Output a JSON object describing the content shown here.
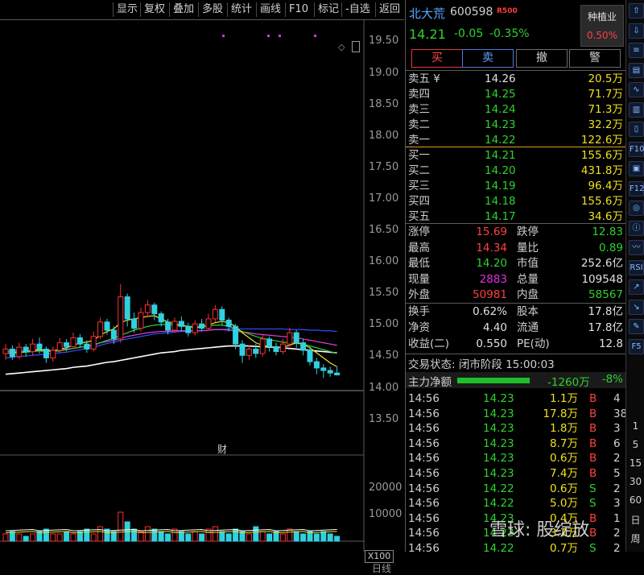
{
  "toolbar": {
    "buttons": [
      "显示",
      "复权",
      "叠加",
      "多股",
      "统计",
      "画线",
      "F10",
      "标记",
      "-自选",
      "返回"
    ]
  },
  "chart": {
    "price_ticks": [
      "19.50",
      "19.00",
      "18.50",
      "18.00",
      "17.50",
      "17.00",
      "16.50",
      "16.00",
      "15.50",
      "15.00",
      "14.50",
      "14.00",
      "13.50"
    ],
    "volume_ticks": [
      "20000",
      "10000"
    ],
    "marker": "财",
    "zoom": "X100",
    "period": "日线",
    "candles": [
      {
        "o": 14.55,
        "c": 14.62,
        "h": 14.7,
        "l": 14.45
      },
      {
        "o": 14.62,
        "c": 14.5,
        "h": 14.68,
        "l": 14.45
      },
      {
        "o": 14.5,
        "c": 14.65,
        "h": 14.72,
        "l": 14.46
      },
      {
        "o": 14.65,
        "c": 14.58,
        "h": 14.7,
        "l": 14.5
      },
      {
        "o": 14.58,
        "c": 14.7,
        "h": 14.78,
        "l": 14.52
      },
      {
        "o": 14.7,
        "c": 14.62,
        "h": 14.8,
        "l": 14.55
      },
      {
        "o": 14.62,
        "c": 14.48,
        "h": 14.66,
        "l": 14.4
      },
      {
        "o": 14.48,
        "c": 14.6,
        "h": 14.66,
        "l": 14.42
      },
      {
        "o": 14.6,
        "c": 14.72,
        "h": 14.8,
        "l": 14.56
      },
      {
        "o": 14.72,
        "c": 14.66,
        "h": 14.78,
        "l": 14.58
      },
      {
        "o": 14.66,
        "c": 14.8,
        "h": 14.88,
        "l": 14.62
      },
      {
        "o": 14.8,
        "c": 14.7,
        "h": 14.86,
        "l": 14.64
      },
      {
        "o": 14.7,
        "c": 14.62,
        "h": 14.76,
        "l": 14.56
      },
      {
        "o": 14.62,
        "c": 14.82,
        "h": 14.9,
        "l": 14.58
      },
      {
        "o": 14.82,
        "c": 15.05,
        "h": 15.12,
        "l": 14.78
      },
      {
        "o": 15.05,
        "c": 14.92,
        "h": 15.1,
        "l": 14.85
      },
      {
        "o": 14.92,
        "c": 14.78,
        "h": 14.98,
        "l": 14.7
      },
      {
        "o": 14.78,
        "c": 15.45,
        "h": 15.65,
        "l": 14.72
      },
      {
        "o": 15.45,
        "c": 15.1,
        "h": 15.5,
        "l": 14.98
      },
      {
        "o": 15.1,
        "c": 14.95,
        "h": 15.2,
        "l": 14.88
      },
      {
        "o": 14.95,
        "c": 15.2,
        "h": 15.28,
        "l": 14.9
      },
      {
        "o": 15.2,
        "c": 15.32,
        "h": 15.4,
        "l": 15.12
      },
      {
        "o": 15.32,
        "c": 15.18,
        "h": 15.36,
        "l": 15.08
      },
      {
        "o": 15.18,
        "c": 15.05,
        "h": 15.22,
        "l": 14.98
      },
      {
        "o": 15.05,
        "c": 14.92,
        "h": 15.1,
        "l": 14.85
      },
      {
        "o": 14.92,
        "c": 15.06,
        "h": 15.12,
        "l": 14.88
      },
      {
        "o": 15.06,
        "c": 14.98,
        "h": 15.14,
        "l": 14.9
      },
      {
        "o": 14.98,
        "c": 14.88,
        "h": 15.04,
        "l": 14.82
      },
      {
        "o": 14.88,
        "c": 15.02,
        "h": 15.08,
        "l": 14.84
      },
      {
        "o": 15.02,
        "c": 14.95,
        "h": 15.1,
        "l": 14.9
      },
      {
        "o": 14.95,
        "c": 15.1,
        "h": 15.18,
        "l": 14.92
      },
      {
        "o": 15.1,
        "c": 15.25,
        "h": 15.32,
        "l": 15.05
      },
      {
        "o": 15.25,
        "c": 15.08,
        "h": 15.3,
        "l": 15.0
      },
      {
        "o": 15.08,
        "c": 14.98,
        "h": 15.12,
        "l": 14.9
      },
      {
        "o": 14.98,
        "c": 14.7,
        "h": 15.02,
        "l": 14.62
      },
      {
        "o": 14.7,
        "c": 14.52,
        "h": 14.76,
        "l": 14.4
      },
      {
        "o": 14.52,
        "c": 14.62,
        "h": 14.68,
        "l": 14.45
      },
      {
        "o": 14.62,
        "c": 14.55,
        "h": 14.7,
        "l": 14.48
      },
      {
        "o": 14.55,
        "c": 14.78,
        "h": 14.86,
        "l": 14.5
      },
      {
        "o": 14.78,
        "c": 14.66,
        "h": 14.82,
        "l": 14.58
      },
      {
        "o": 14.66,
        "c": 14.58,
        "h": 14.72,
        "l": 14.52
      },
      {
        "o": 14.58,
        "c": 14.7,
        "h": 14.78,
        "l": 14.54
      },
      {
        "o": 14.7,
        "c": 14.88,
        "h": 14.96,
        "l": 14.66
      },
      {
        "o": 14.88,
        "c": 14.72,
        "h": 14.92,
        "l": 14.64
      },
      {
        "o": 14.72,
        "c": 14.6,
        "h": 14.78,
        "l": 14.52
      },
      {
        "o": 14.6,
        "c": 14.42,
        "h": 14.66,
        "l": 14.36
      },
      {
        "o": 14.42,
        "c": 14.32,
        "h": 14.48,
        "l": 14.22
      },
      {
        "o": 14.32,
        "c": 14.28,
        "h": 14.38,
        "l": 14.16
      },
      {
        "o": 14.28,
        "c": 14.24,
        "h": 14.34,
        "l": 14.18
      },
      {
        "o": 14.24,
        "c": 14.21,
        "h": 14.34,
        "l": 14.2
      }
    ],
    "ma_lines": [
      {
        "color": "#ffffff",
        "values": [
          14.22,
          14.23,
          14.24,
          14.25,
          14.26,
          14.27,
          14.28,
          14.29,
          14.3,
          14.31,
          14.33,
          14.34,
          14.35,
          14.37,
          14.39,
          14.41,
          14.42,
          14.44,
          14.46,
          14.48,
          14.5,
          14.52,
          14.54,
          14.56,
          14.57,
          14.58,
          14.6,
          14.61,
          14.62,
          14.63,
          14.64,
          14.65,
          14.66,
          14.67,
          14.67,
          14.67,
          14.67,
          14.66,
          14.66,
          14.65,
          14.65,
          14.64,
          14.63,
          14.62,
          14.61,
          14.6,
          14.59,
          14.58,
          14.57,
          14.56
        ]
      },
      {
        "color": "#3050ff",
        "values": [
          14.48,
          14.49,
          14.5,
          14.51,
          14.52,
          14.53,
          14.54,
          14.55,
          14.56,
          14.57,
          14.59,
          14.61,
          14.63,
          14.65,
          14.68,
          14.71,
          14.73,
          14.76,
          14.78,
          14.8,
          14.82,
          14.84,
          14.86,
          14.87,
          14.88,
          14.89,
          14.9,
          14.9,
          14.91,
          14.91,
          14.92,
          14.93,
          14.93,
          14.94,
          14.94,
          14.94,
          14.94,
          14.94,
          14.94,
          14.94,
          14.94,
          14.94,
          14.93,
          14.93,
          14.93,
          14.92,
          14.92,
          14.91,
          14.91,
          14.9
        ]
      },
      {
        "color": "#e040e0",
        "values": [
          14.6,
          14.6,
          14.59,
          14.59,
          14.59,
          14.6,
          14.6,
          14.6,
          14.61,
          14.62,
          14.63,
          14.65,
          14.67,
          14.69,
          14.72,
          14.74,
          14.76,
          14.79,
          14.82,
          14.84,
          14.86,
          14.88,
          14.89,
          14.9,
          14.9,
          14.91,
          14.91,
          14.91,
          14.91,
          14.91,
          14.92,
          14.93,
          14.93,
          14.92,
          14.91,
          14.89,
          14.88,
          14.86,
          14.85,
          14.84,
          14.83,
          14.82,
          14.81,
          14.8,
          14.78,
          14.76,
          14.74,
          14.72,
          14.7,
          14.68
        ]
      },
      {
        "color": "#30d030",
        "values": [
          14.58,
          14.58,
          14.57,
          14.57,
          14.58,
          14.59,
          14.58,
          14.58,
          14.59,
          14.61,
          14.63,
          14.65,
          14.66,
          14.68,
          14.72,
          14.76,
          14.79,
          14.84,
          14.88,
          14.92,
          14.95,
          14.98,
          15.0,
          15.01,
          15.01,
          15.0,
          14.99,
          14.98,
          14.98,
          14.98,
          14.99,
          15.0,
          15.0,
          14.98,
          14.94,
          14.9,
          14.86,
          14.82,
          14.79,
          14.77,
          14.75,
          14.73,
          14.72,
          14.71,
          14.7,
          14.67,
          14.64,
          14.61,
          14.58,
          14.55
        ]
      },
      {
        "color": "#f0e020",
        "values": [
          14.55,
          14.56,
          14.56,
          14.58,
          14.6,
          14.61,
          14.6,
          14.59,
          14.62,
          14.64,
          14.68,
          14.72,
          14.73,
          14.76,
          14.84,
          14.9,
          14.94,
          15.04,
          15.08,
          15.1,
          15.12,
          15.14,
          15.15,
          15.1,
          15.05,
          15.02,
          15.0,
          14.98,
          14.96,
          14.97,
          15.0,
          15.04,
          15.06,
          15.04,
          14.98,
          14.88,
          14.8,
          14.72,
          14.68,
          14.66,
          14.64,
          14.65,
          14.68,
          14.72,
          14.7,
          14.64,
          14.56,
          14.48,
          14.4,
          14.34
        ]
      }
    ],
    "volumes": [
      3,
      4,
      3,
      2,
      3,
      4,
      5,
      3,
      3,
      4,
      3,
      4,
      5,
      3,
      6,
      5,
      4,
      12,
      8,
      5,
      4,
      6,
      5,
      4,
      3,
      5,
      4,
      3,
      4,
      3,
      5,
      6,
      4,
      3,
      5,
      4,
      3,
      6,
      4,
      3,
      4,
      3,
      5,
      4,
      3,
      4,
      3,
      4,
      3,
      2
    ],
    "volume_colors": [
      1,
      0,
      1,
      0,
      1,
      0,
      0,
      1,
      1,
      0,
      1,
      0,
      0,
      1,
      1,
      0,
      0,
      1,
      0,
      0,
      1,
      1,
      0,
      0,
      0,
      1,
      0,
      0,
      1,
      0,
      1,
      1,
      0,
      0,
      0,
      0,
      1,
      0,
      1,
      0,
      0,
      1,
      1,
      0,
      0,
      0,
      0,
      0,
      0,
      0
    ]
  },
  "quote": {
    "name": "北大荒",
    "code": "600598",
    "badge": "R500",
    "price": "14.21",
    "change": "-0.05",
    "change_pct": "-0.35%",
    "sector": "种植业",
    "sector_pct": "0.50%"
  },
  "actions": {
    "buy": "买",
    "sell": "卖",
    "cancel": "撤",
    "alert": "警"
  },
  "asks": [
    {
      "label": "卖五 ¥",
      "price": "14.26",
      "vol": "20.5万"
    },
    {
      "label": "卖四",
      "price": "14.25",
      "vol": "71.7万"
    },
    {
      "label": "卖三",
      "price": "14.24",
      "vol": "71.3万"
    },
    {
      "label": "卖二",
      "price": "14.23",
      "vol": "32.2万"
    },
    {
      "label": "卖一",
      "price": "14.22",
      "vol": "122.6万"
    }
  ],
  "bids": [
    {
      "label": "买一",
      "price": "14.21",
      "vol": "155.6万"
    },
    {
      "label": "买二",
      "price": "14.20",
      "vol": "431.8万"
    },
    {
      "label": "买三",
      "price": "14.19",
      "vol": "96.4万"
    },
    {
      "label": "买四",
      "price": "14.18",
      "vol": "155.6万"
    },
    {
      "label": "买五",
      "price": "14.17",
      "vol": "34.6万"
    }
  ],
  "stats1": [
    {
      "l1": "涨停",
      "v1": "15.69",
      "c1": "red",
      "l2": "跌停",
      "v2": "12.83",
      "c2": "green"
    },
    {
      "l1": "最高",
      "v1": "14.34",
      "c1": "red",
      "l2": "量比",
      "v2": "0.89",
      "c2": "green"
    },
    {
      "l1": "最低",
      "v1": "14.20",
      "c1": "green",
      "l2": "市值",
      "v2": "252.6亿",
      "c2": "white"
    },
    {
      "l1": "现量",
      "v1": "2883",
      "c1": "magenta",
      "l2": "总量",
      "v2": "109548",
      "c2": "white"
    },
    {
      "l1": "外盘",
      "v1": "50981",
      "c1": "red",
      "l2": "内盘",
      "v2": "58567",
      "c2": "green"
    }
  ],
  "stats2": [
    {
      "l1": "换手",
      "v1": "0.62%",
      "c1": "white",
      "l2": "股本",
      "v2": "17.8亿",
      "c2": "white"
    },
    {
      "l1": "净资",
      "v1": "4.40",
      "c1": "white",
      "l2": "流通",
      "v2": "17.8亿",
      "c2": "white"
    },
    {
      "l1": "收益(二)",
      "v1": "0.550",
      "c1": "white",
      "l2": "PE(动)",
      "v2": "12.8",
      "c2": "white"
    }
  ],
  "trade_status": "交易状态: 闭市阶段 15:00:03",
  "flow": {
    "label": "主力净额",
    "value": "-1260万",
    "pct": "-8%"
  },
  "ticks": [
    {
      "t": "14:56",
      "p": "14.23",
      "v": "1.1万",
      "bs": "B",
      "n": "4"
    },
    {
      "t": "14:56",
      "p": "14.23",
      "v": "17.8万",
      "bs": "B",
      "n": "38"
    },
    {
      "t": "14:56",
      "p": "14.23",
      "v": "1.8万",
      "bs": "B",
      "n": "3"
    },
    {
      "t": "14:56",
      "p": "14.23",
      "v": "8.7万",
      "bs": "B",
      "n": "6"
    },
    {
      "t": "14:56",
      "p": "14.23",
      "v": "0.6万",
      "bs": "B",
      "n": "2"
    },
    {
      "t": "14:56",
      "p": "14.23",
      "v": "7.4万",
      "bs": "B",
      "n": "5"
    },
    {
      "t": "14:56",
      "p": "14.22",
      "v": "0.6万",
      "bs": "S",
      "n": "2"
    },
    {
      "t": "14:56",
      "p": "14.22",
      "v": "5.0万",
      "bs": "S",
      "n": "3"
    },
    {
      "t": "14:56",
      "p": "14.23",
      "v": "0.4万",
      "bs": "B",
      "n": "1"
    },
    {
      "t": "14:56",
      "p": "14.23",
      "v": "3.7万",
      "bs": "B",
      "n": "2"
    },
    {
      "t": "14:56",
      "p": "14.22",
      "v": "0.7万",
      "bs": "S",
      "n": "2"
    }
  ],
  "watermark": "雪球: 股绽放",
  "side_tools": {
    "icons": [
      "up-icon",
      "down-icon",
      "list-icon",
      "table-icon",
      "chart-line-icon",
      "chart-bar-icon",
      "candle-icon",
      "f10-icon",
      "news-icon",
      "f12-icon",
      "stock-icon",
      "info-icon",
      "macd-icon",
      "rsi-icon",
      "chart-up-icon",
      "chart-down-icon",
      "pencil-icon",
      "f5-icon"
    ],
    "icon_labels": [
      "⇧",
      "⇩",
      "≡",
      "▤",
      "∿",
      "▥",
      "▯",
      "F10",
      "▣",
      "F12",
      "◎",
      "ⓘ",
      "〰",
      "RSI",
      "↗",
      "↘",
      "✎",
      "F5"
    ],
    "periods": [
      "1",
      "5",
      "15",
      "30",
      "60",
      "日",
      "周"
    ]
  }
}
